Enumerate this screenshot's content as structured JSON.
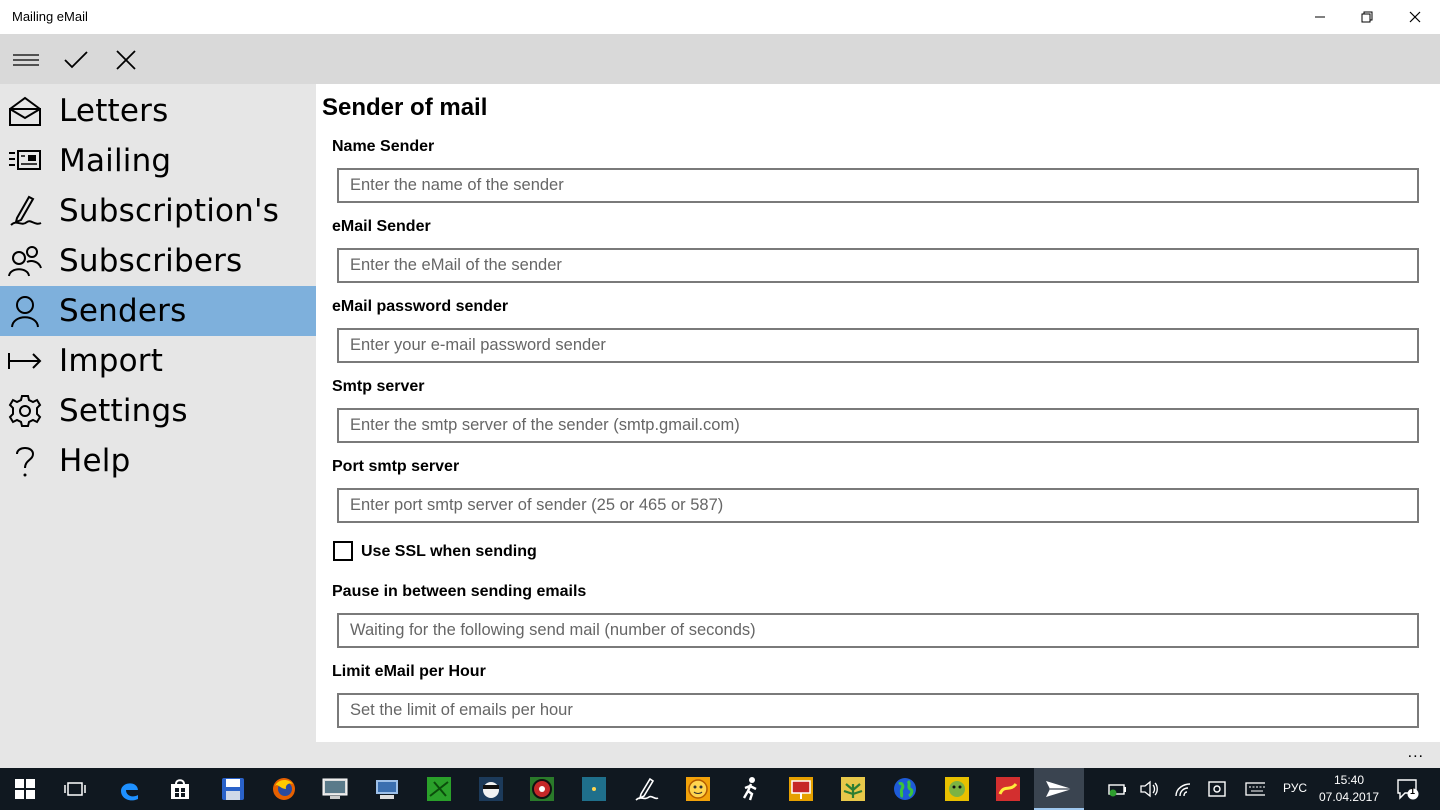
{
  "window": {
    "title": "Mailing eMail"
  },
  "toolbar": {
    "menu_icon": "hamburger-icon",
    "accept_icon": "checkmark-icon",
    "cancel_icon": "close-icon"
  },
  "sidebar": {
    "items": [
      {
        "label": "Letters",
        "icon": "envelope-open-icon",
        "active": false
      },
      {
        "label": "Mailing",
        "icon": "news-list-icon",
        "active": false
      },
      {
        "label": "Subscription's",
        "icon": "signature-pen-icon",
        "active": false
      },
      {
        "label": "Subscribers",
        "icon": "people-icon",
        "active": false
      },
      {
        "label": "Senders",
        "icon": "person-icon",
        "active": true
      },
      {
        "label": "Import",
        "icon": "import-arrow-icon",
        "active": false
      },
      {
        "label": "Settings",
        "icon": "gear-icon",
        "active": false
      },
      {
        "label": "Help",
        "icon": "question-icon",
        "active": false
      }
    ],
    "active_color": "#7eb0dc"
  },
  "form": {
    "title": "Sender of mail",
    "fields": [
      {
        "label": "Name Sender",
        "placeholder": "Enter the name of the sender",
        "value": ""
      },
      {
        "label": "eMail Sender",
        "placeholder": "Enter the eMail of the sender",
        "value": ""
      },
      {
        "label": "eMail password sender",
        "placeholder": "Enter your e-mail password sender",
        "value": ""
      },
      {
        "label": "Smtp server",
        "placeholder": "Enter the smtp server of the sender (smtp.gmail.com)",
        "value": ""
      },
      {
        "label": "Port smtp server",
        "placeholder": "Enter port smtp server of sender (25 or 465 or 587)",
        "value": ""
      }
    ],
    "ssl": {
      "label": "Use SSL when sending",
      "checked": false
    },
    "fields2": [
      {
        "label": "Pause in between sending emails",
        "placeholder": "Waiting for the following send mail (number of seconds)",
        "value": ""
      },
      {
        "label": "Limit eMail per Hour",
        "placeholder": "Set the limit of emails per hour",
        "value": ""
      }
    ]
  },
  "statusbar": {
    "more_label": "..."
  },
  "taskbar": {
    "language": "РУС",
    "time": "15:40",
    "date": "07.04.2017",
    "notification_count": "1"
  }
}
